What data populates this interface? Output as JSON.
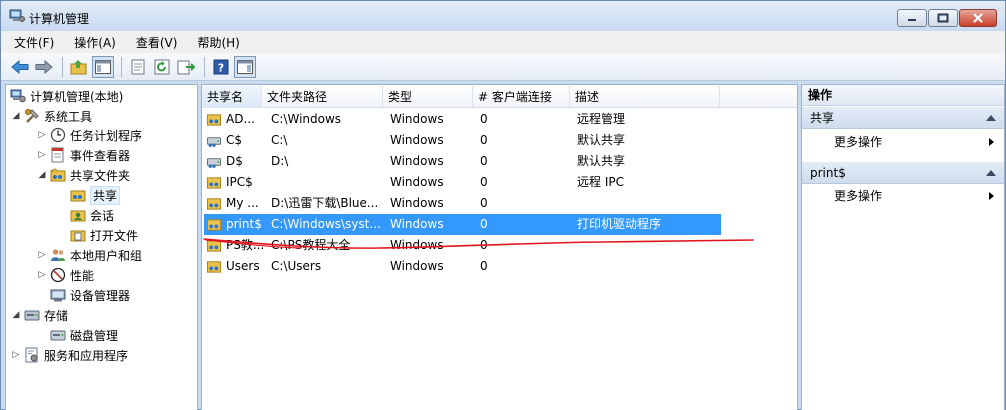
{
  "window": {
    "title": "计算机管理"
  },
  "menu": [
    "文件(F)",
    "操作(A)",
    "查看(V)",
    "帮助(H)"
  ],
  "tree": [
    {
      "label": "计算机管理(本地)",
      "icon": "computer-management-icon",
      "expander": "none"
    },
    {
      "label": "系统工具",
      "icon": "system-tools-icon",
      "expander": "expanded"
    },
    {
      "label": "任务计划程序",
      "icon": "task-scheduler-icon",
      "expander": "collapsed"
    },
    {
      "label": "事件查看器",
      "icon": "event-viewer-icon",
      "expander": "collapsed"
    },
    {
      "label": "共享文件夹",
      "icon": "shared-folders-icon",
      "expander": "expanded"
    },
    {
      "label": "共享",
      "icon": "share-icon",
      "expander": "none"
    },
    {
      "label": "会话",
      "icon": "sessions-icon",
      "expander": "none"
    },
    {
      "label": "打开文件",
      "icon": "open-files-icon",
      "expander": "none"
    },
    {
      "label": "本地用户和组",
      "icon": "users-groups-icon",
      "expander": "collapsed"
    },
    {
      "label": "性能",
      "icon": "performance-icon",
      "expander": "collapsed"
    },
    {
      "label": "设备管理器",
      "icon": "device-manager-icon",
      "expander": "none"
    },
    {
      "label": "存储",
      "icon": "storage-icon",
      "expander": "expanded"
    },
    {
      "label": "磁盘管理",
      "icon": "disk-management-icon",
      "expander": "none"
    },
    {
      "label": "服务和应用程序",
      "icon": "services-apps-icon",
      "expander": "collapsed"
    }
  ],
  "list": {
    "columns": [
      "共享名",
      "文件夹路径",
      "类型",
      "# 客户端连接",
      "描述"
    ],
    "rows": [
      {
        "name": "AD...",
        "path": "C:\\Windows",
        "type": "Windows",
        "clients": "0",
        "desc": "远程管理",
        "icon": "admin-share-icon"
      },
      {
        "name": "C$",
        "path": "C:\\",
        "type": "Windows",
        "clients": "0",
        "desc": "默认共享",
        "icon": "drive-share-icon"
      },
      {
        "name": "D$",
        "path": "D:\\",
        "type": "Windows",
        "clients": "0",
        "desc": "默认共享",
        "icon": "drive-share-icon"
      },
      {
        "name": "IPC$",
        "path": "",
        "type": "Windows",
        "clients": "0",
        "desc": "远程 IPC",
        "icon": "ipc-share-icon"
      },
      {
        "name": "My ...",
        "path": "D:\\迅雷下载\\Blue...",
        "type": "Windows",
        "clients": "0",
        "desc": "",
        "icon": "folder-share-icon"
      },
      {
        "name": "print$",
        "path": "C:\\Windows\\syst...",
        "type": "Windows",
        "clients": "0",
        "desc": "打印机驱动程序",
        "icon": "folder-share-icon"
      },
      {
        "name": "PS教...",
        "path": "C:\\PS教程大全",
        "type": "Windows",
        "clients": "0",
        "desc": "",
        "icon": "folder-share-icon"
      },
      {
        "name": "Users",
        "path": "C:\\Users",
        "type": "Windows",
        "clients": "0",
        "desc": "",
        "icon": "folder-share-icon"
      }
    ]
  },
  "actions": {
    "header": "操作",
    "sections": [
      {
        "title": "共享",
        "items": [
          "更多操作"
        ]
      },
      {
        "title": "print$",
        "items": [
          "更多操作"
        ]
      }
    ]
  },
  "colors": {
    "selection": "#3399ff",
    "annotation": "#e0141e"
  }
}
